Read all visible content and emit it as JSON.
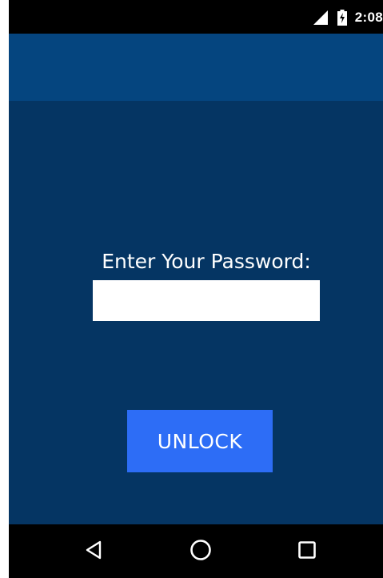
{
  "status_bar": {
    "time": "2:08",
    "icons": [
      "signal-icon",
      "battery-charging-icon"
    ]
  },
  "lock_screen": {
    "prompt_label": "Enter Your Password:",
    "password_value": "",
    "unlock_label": "UNLOCK"
  },
  "nav_bar": {
    "icons": [
      "back-icon",
      "home-icon",
      "recents-icon"
    ]
  },
  "colors": {
    "app_bar": "#05457f",
    "background": "#053563",
    "button": "#2d6df6",
    "text": "#ffffff"
  }
}
